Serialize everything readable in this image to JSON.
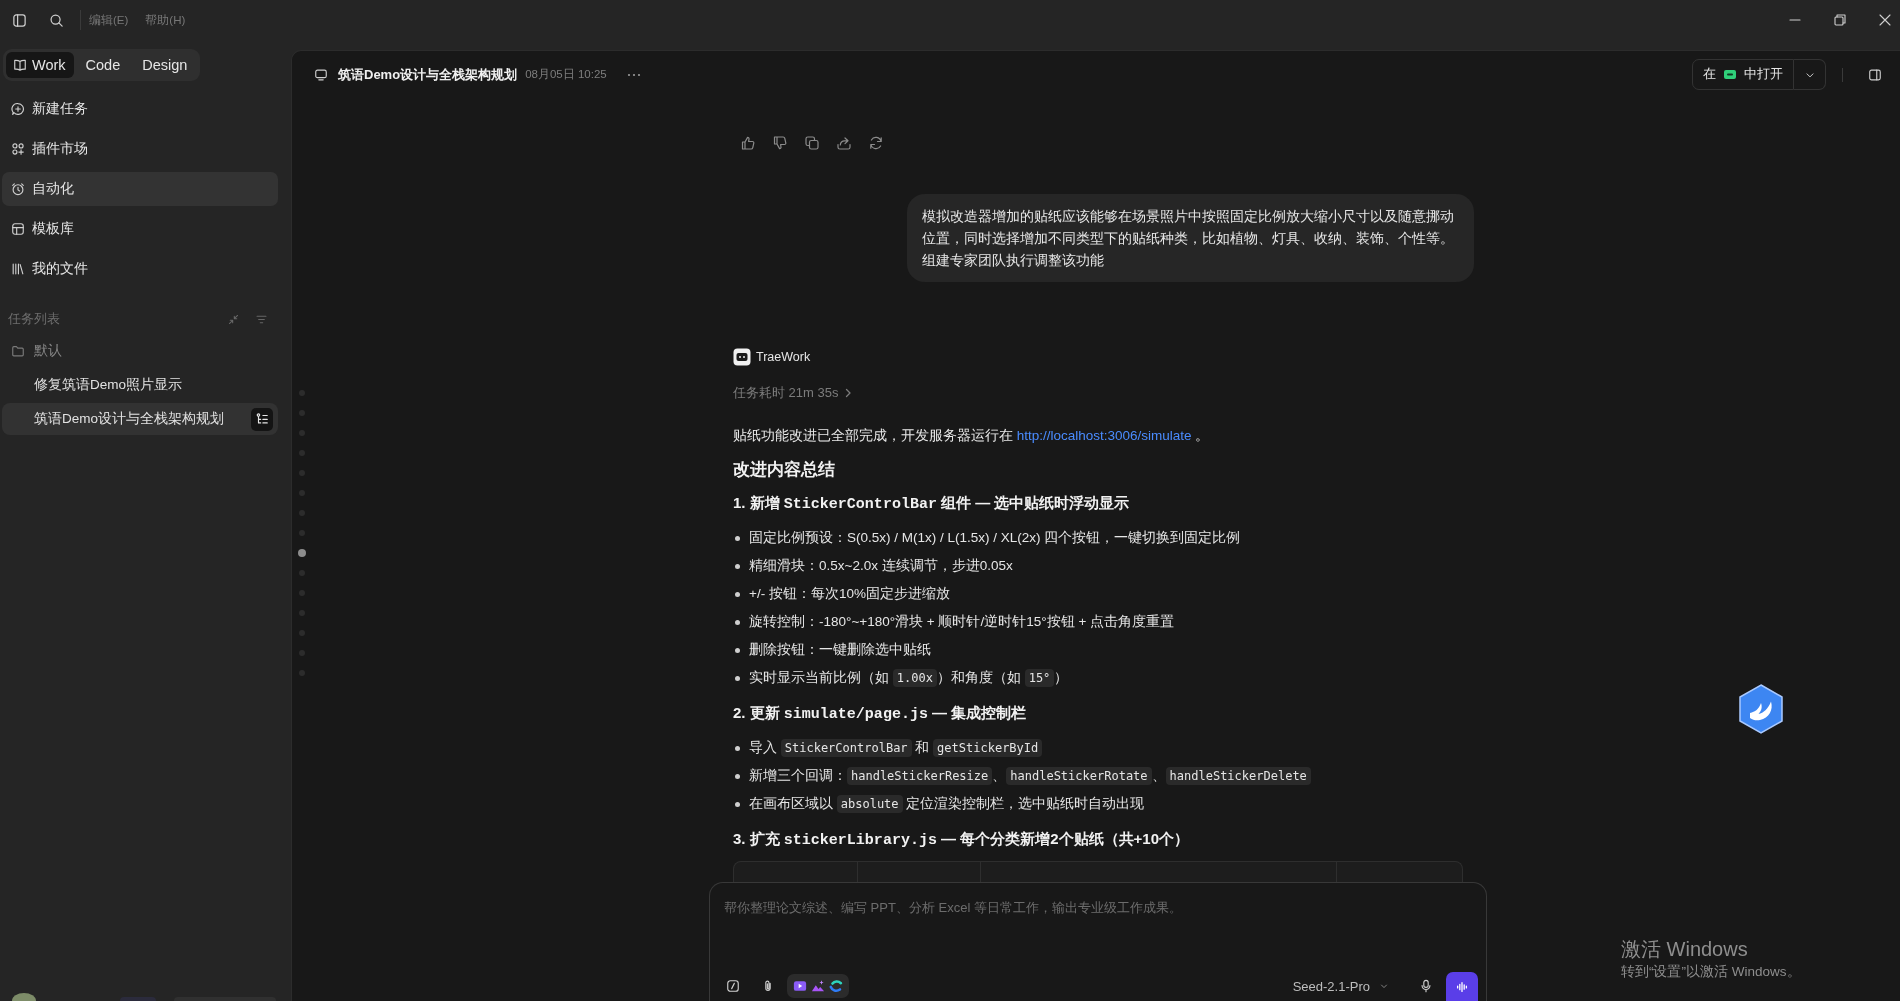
{
  "title_bar": {
    "menus": [
      "编辑(E)",
      "帮助(H)"
    ]
  },
  "mode_tabs": [
    {
      "label": "Work",
      "selected": true
    },
    {
      "label": "Code",
      "selected": false
    },
    {
      "label": "Design",
      "selected": false
    }
  ],
  "nav": [
    {
      "label": "新建任务",
      "selected": false
    },
    {
      "label": "插件市场",
      "selected": false
    },
    {
      "label": "自动化",
      "selected": true
    },
    {
      "label": "模板库",
      "selected": false
    },
    {
      "label": "我的文件",
      "selected": false
    }
  ],
  "task_list": {
    "title": "任务列表",
    "folders": [
      {
        "name": "默认",
        "children": [
          {
            "label": "修复筑语Demo照片显示",
            "selected": false
          },
          {
            "label": "筑语Demo设计与全栈架构规划",
            "selected": true
          }
        ]
      }
    ]
  },
  "conversation": {
    "title": "筑语Demo设计与全栈架构规划",
    "date": "08月05日 10:25",
    "open_in": {
      "before": "在",
      "after": "中打开"
    }
  },
  "message_nav": [
    {
      "selected": false
    },
    {
      "selected": false
    },
    {
      "selected": false
    },
    {
      "selected": false
    },
    {
      "selected": false
    },
    {
      "selected": false
    },
    {
      "selected": false
    },
    {
      "selected": false
    },
    {
      "selected": true
    },
    {
      "selected": false
    },
    {
      "selected": false
    },
    {
      "selected": false
    },
    {
      "selected": false
    },
    {
      "selected": false
    },
    {
      "selected": false
    }
  ],
  "user_message": {
    "paragraphs": [
      "模拟改造器增加的贴纸应该能够在场景照片中按照固定比例放大缩小尺寸以及随意挪动位置，同时选择增加不同类型下的贴纸种类，比如植物、灯具、收纳、装饰、个性等。",
      "组建专家团队执行调整该功能"
    ]
  },
  "assistant": {
    "name": "TraeWork",
    "duration": "任务耗时 21m 35s",
    "intro": [
      {
        "kind": "text",
        "text": "贴纸功能改进已全部完成，开发服务器运行在 "
      },
      {
        "kind": "link",
        "text": "http://localhost:3006/simulate"
      },
      {
        "kind": "text",
        "text": " 。"
      }
    ],
    "summary_heading": "改进内容总结",
    "sections": [
      {
        "heading": [
          {
            "kind": "text",
            "text": "1. 新增 "
          },
          {
            "kind": "code",
            "text": "StickerControlBar"
          },
          {
            "kind": "text",
            "text": " 组件 — 选中贴纸时浮动显示"
          }
        ],
        "bullets": [
          [
            {
              "kind": "text",
              "text": "固定比例预设：S(0.5x) / M(1x) / L(1.5x) / XL(2x) 四个按钮，一键切换到固定比例"
            }
          ],
          [
            {
              "kind": "text",
              "text": "精细滑块：0.5x~2.0x 连续调节，步进0.05x"
            }
          ],
          [
            {
              "kind": "text",
              "text": "+/- 按钮：每次10%固定步进缩放"
            }
          ],
          [
            {
              "kind": "text",
              "text": "旋转控制：-180°~+180°滑块 + 顺时针/逆时针15°按钮 + 点击角度重置"
            }
          ],
          [
            {
              "kind": "text",
              "text": "删除按钮：一键删除选中贴纸"
            }
          ],
          [
            {
              "kind": "text",
              "text": "实时显示当前比例（如 "
            },
            {
              "kind": "code",
              "text": "1.00x"
            },
            {
              "kind": "text",
              "text": "）和角度（如 "
            },
            {
              "kind": "code",
              "text": "15°"
            },
            {
              "kind": "text",
              "text": "）"
            }
          ]
        ]
      },
      {
        "heading": [
          {
            "kind": "text",
            "text": "2. 更新 "
          },
          {
            "kind": "code",
            "text": "simulate/page.js"
          },
          {
            "kind": "text",
            "text": " — 集成控制栏"
          }
        ],
        "bullets": [
          [
            {
              "kind": "text",
              "text": "导入 "
            },
            {
              "kind": "code",
              "text": "StickerControlBar"
            },
            {
              "kind": "text",
              "text": " 和 "
            },
            {
              "kind": "code",
              "text": "getStickerById"
            }
          ],
          [
            {
              "kind": "text",
              "text": "新增三个回调："
            },
            {
              "kind": "code",
              "text": "handleStickerResize"
            },
            {
              "kind": "text",
              "text": "、"
            },
            {
              "kind": "code",
              "text": "handleStickerRotate"
            },
            {
              "kind": "text",
              "text": "、"
            },
            {
              "kind": "code",
              "text": "handleStickerDelete"
            }
          ],
          [
            {
              "kind": "text",
              "text": "在画布区域以 "
            },
            {
              "kind": "code",
              "text": "absolute"
            },
            {
              "kind": "text",
              "text": " 定位渲染控制栏，选中贴纸时自动出现"
            }
          ]
        ]
      },
      {
        "heading": [
          {
            "kind": "text",
            "text": "3. 扩充 "
          },
          {
            "kind": "code",
            "text": "stickerLibrary.js"
          },
          {
            "kind": "text",
            "text": " — 每个分类新增2个贴纸（共+10个）"
          }
        ]
      }
    ]
  },
  "composer": {
    "placeholder": "帮你整理论文综述、编写 PPT、分析 Excel 等日常工作，输出专业级工作成果。",
    "model": "Seed-2.1-Pro"
  },
  "windows_notice": {
    "title": "激活 Windows",
    "subtitle": "转到“设置”以激活 Windows。"
  }
}
